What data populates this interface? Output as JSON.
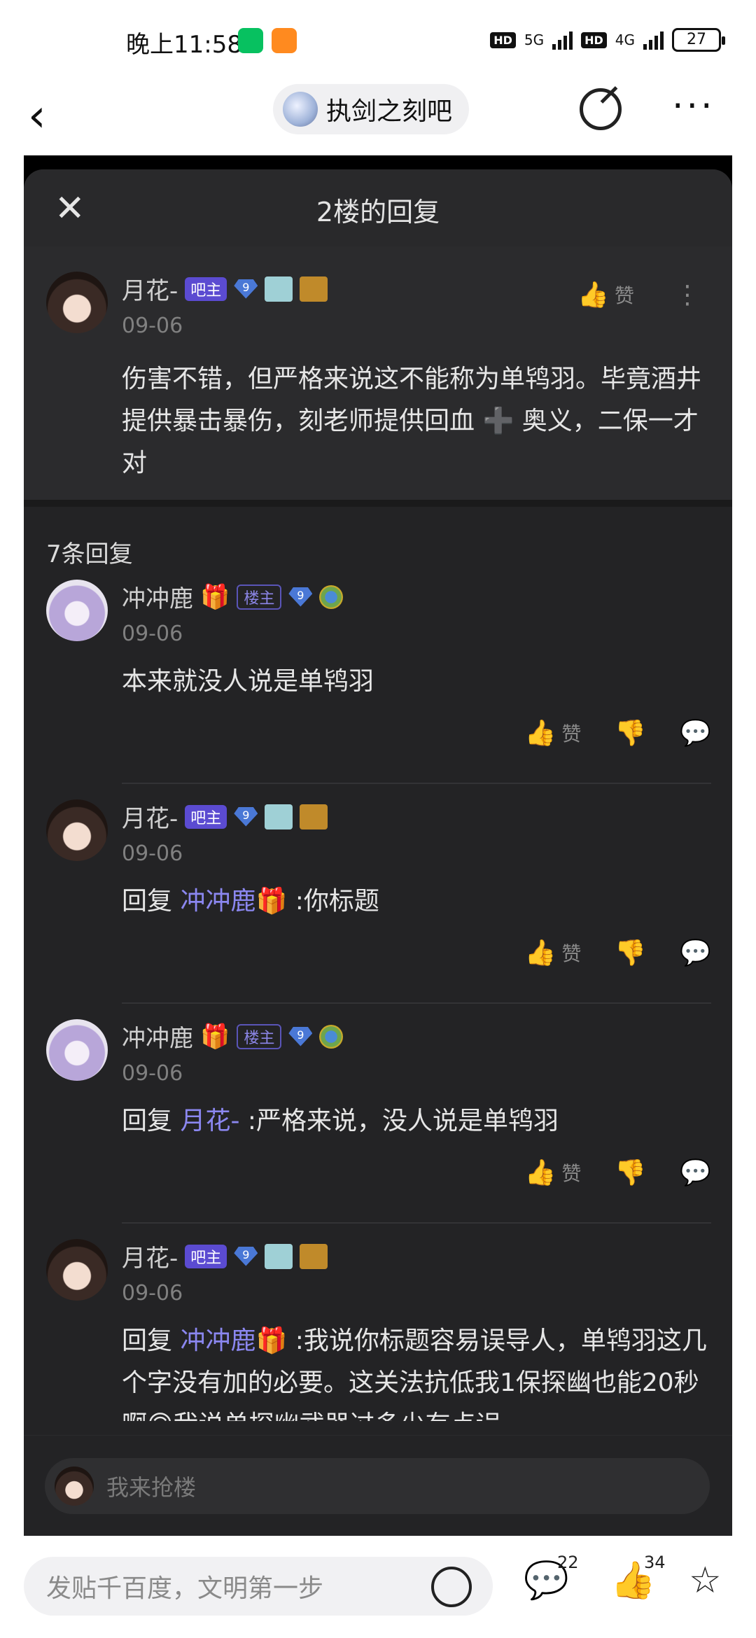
{
  "status_bar": {
    "time": "晚上11:58",
    "net1": "5G",
    "net2": "4G",
    "hd": "HD",
    "battery": "27"
  },
  "nav": {
    "forum_name": "执剑之刻吧"
  },
  "panel": {
    "title": "2楼的回复",
    "main_post": {
      "user": "月花-",
      "owner_badge": "吧主",
      "level": "9",
      "date": "09-06",
      "like_label": "赞",
      "text": "伤害不错，但严格来说这不能称为单鸨羽。毕竟酒井提供暴击暴伤，刻老师提供回血 ➕ 奥义，二保一才对"
    },
    "reply_count": "7条回复",
    "replies": [
      {
        "user": "冲冲鹿",
        "badge": "楼主",
        "level": "9",
        "date": "09-06",
        "prefix": "",
        "at": "",
        "text": "本来就没人说是单鸨羽",
        "like_label": "赞"
      },
      {
        "user": "月花-",
        "badge": "吧主",
        "level": "9",
        "date": "09-06",
        "prefix": "回复 ",
        "at": "冲冲鹿🎁",
        "text": " :你标题",
        "like_label": "赞"
      },
      {
        "user": "冲冲鹿",
        "badge": "楼主",
        "level": "9",
        "date": "09-06",
        "prefix": "回复 ",
        "at": "月花-",
        "text": " :严格来说，没人说是单鸨羽",
        "like_label": "赞"
      },
      {
        "user": "月花-",
        "badge": "吧主",
        "level": "9",
        "date": "09-06",
        "prefix": "回复 ",
        "at": "冲冲鹿🎁",
        "text": " :我说你标题容易误导人，单鸨羽这几个字没有加的必要。这关法抗低我1保探幽也能20秒啊🙃我说单探幽武器过多少有点误",
        "like_label": "赞"
      }
    ],
    "input_placeholder": "我来抢楼"
  },
  "bottom_bar": {
    "placeholder": "发贴千百度，文明第一步",
    "comments": "22",
    "likes": "34"
  }
}
